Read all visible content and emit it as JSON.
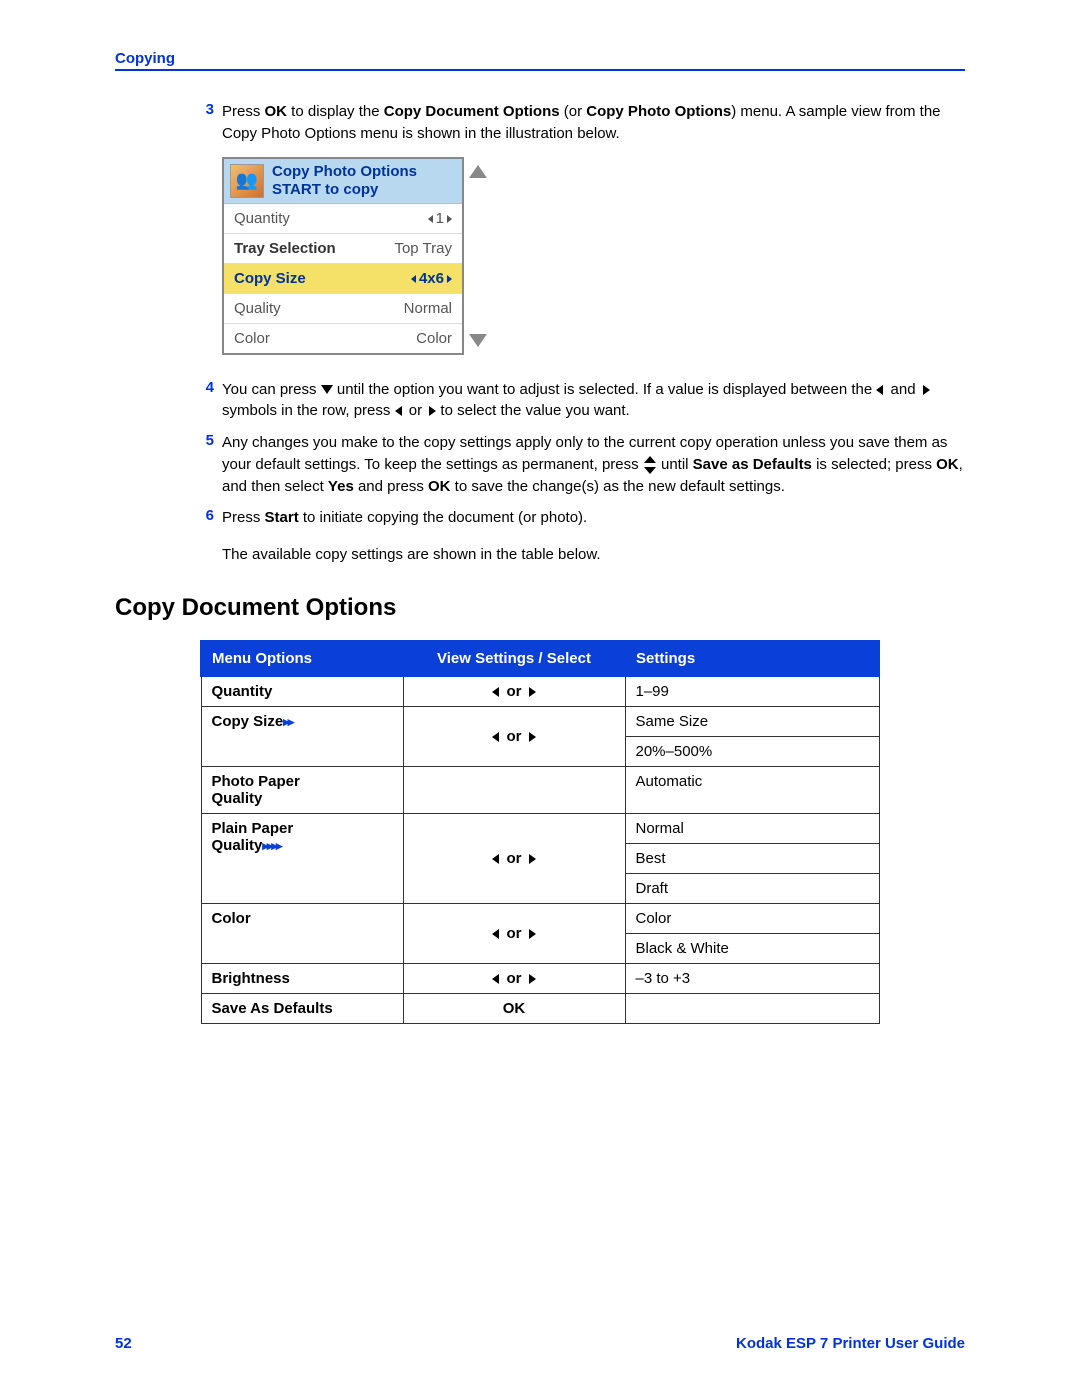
{
  "header": {
    "section": "Copying"
  },
  "steps": {
    "s3": {
      "num": "3",
      "t1": "Press ",
      "b1": "OK",
      "t2": " to display the ",
      "b2": "Copy Document Options",
      "t3": " (or ",
      "b3": "Copy Photo Options",
      "t4": ") menu. A sample view from the Copy Photo Options menu is shown in the illustration below."
    },
    "s4": {
      "num": "4",
      "t1": "You can press ",
      "t2": " until the option you want to adjust is selected. If a value is displayed between the ",
      "t3": " and ",
      "t4": " symbols in the row, press ",
      "t5": " or ",
      "t6": " to select the value you want."
    },
    "s5": {
      "num": "5",
      "t1": "Any changes you make to the copy settings apply only to the current copy operation unless you save them as your default settings. To keep the settings as permanent, press ",
      "t2": " until ",
      "b1": "Save as Defaults",
      "t3": " is selected; press ",
      "b2": "OK",
      "t4": ", and then select ",
      "b3": "Yes",
      "t5": " and press ",
      "b4": "OK",
      "t6": " to save the change(s) as the new default settings."
    },
    "s6": {
      "num": "6",
      "t1": "Press ",
      "b1": "Start",
      "t2": " to initiate copying the document (or photo)."
    },
    "after6": "The available copy settings are shown in the table below."
  },
  "lcd": {
    "title1": "Copy Photo Options",
    "title2": "START to copy",
    "rows": [
      {
        "label": "Quantity",
        "value": "1",
        "arrows": true
      },
      {
        "label": "Tray Selection",
        "value": "Top Tray",
        "arrows": false,
        "dark": true
      },
      {
        "label": "Copy Size",
        "value": "4x6",
        "arrows": true,
        "selected": true
      },
      {
        "label": "Quality",
        "value": "Normal",
        "arrows": false
      },
      {
        "label": "Color",
        "value": "Color",
        "arrows": false
      }
    ]
  },
  "section_title": "Copy Document Options",
  "table": {
    "headers": {
      "c1": "Menu Options",
      "c2": "View Settings / Select",
      "c3": "Settings"
    },
    "or": "or",
    "ok": "OK",
    "rows": {
      "quantity": {
        "label": "Quantity",
        "settings": [
          "1–99"
        ]
      },
      "copysize": {
        "label": "Copy Size",
        "note": "**",
        "settings": [
          "Same Size",
          "20%–500%"
        ]
      },
      "photopaper": {
        "label1": "Photo Paper",
        "label2": "Quality",
        "settings": [
          "Automatic"
        ]
      },
      "plainpaper": {
        "label1": "Plain Paper",
        "label2": "Quality",
        "note": "****",
        "settings": [
          "Normal",
          "Best",
          "Draft"
        ]
      },
      "color": {
        "label": "Color",
        "settings": [
          "Color",
          "Black & White"
        ]
      },
      "brightness": {
        "label": "Brightness",
        "settings": [
          "–3 to +3"
        ]
      },
      "save": {
        "label": "Save As Defaults"
      }
    }
  },
  "footer": {
    "page": "52",
    "guide": "Kodak ESP 7 Printer User Guide"
  }
}
